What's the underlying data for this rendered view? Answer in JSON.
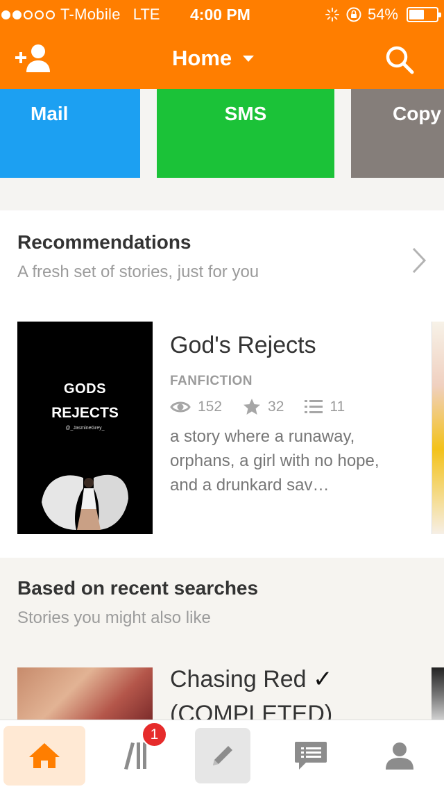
{
  "status_bar": {
    "carrier": "T-Mobile",
    "network": "LTE",
    "time": "4:00 PM",
    "battery": "54%",
    "battery_level": 0.54,
    "signal_bars": 2
  },
  "header": {
    "title": "Home",
    "left_icon": "add-user-icon",
    "right_icon": "search-icon",
    "background_color": "#ff7e00"
  },
  "share_options": [
    {
      "label": "Mail",
      "color": "#1ca0f2"
    },
    {
      "label": "SMS",
      "color": "#1bc238"
    },
    {
      "label": "Copy",
      "color": "#857e7a"
    }
  ],
  "recommendations": {
    "title": "Recommendations",
    "subtitle": "A fresh set of stories, just for you",
    "story": {
      "title": "God's Rejects",
      "cover_line1": "GODS",
      "cover_line2": "REJECTS",
      "cover_author": "@_JasmineGrey_",
      "category": "FANFICTION",
      "views": "152",
      "votes": "32",
      "parts": "11",
      "description": "a story where a runaway, orphans, a girl with no hope, and a drunkard sav…"
    }
  },
  "recent_searches": {
    "title": "Based on recent searches",
    "subtitle": "Stories you might also like",
    "story": {
      "title_line1": "Chasing Red",
      "checkmark": "✓",
      "title_line2": "(COMPLETED)"
    }
  },
  "tab_bar": {
    "tabs": [
      {
        "name": "home",
        "icon": "home-icon",
        "active": true
      },
      {
        "name": "library",
        "icon": "library-icon",
        "badge": "1"
      },
      {
        "name": "write",
        "icon": "pencil-icon"
      },
      {
        "name": "messages",
        "icon": "chat-icon"
      },
      {
        "name": "profile",
        "icon": "profile-icon"
      }
    ],
    "active_color": "#ff7e00"
  }
}
